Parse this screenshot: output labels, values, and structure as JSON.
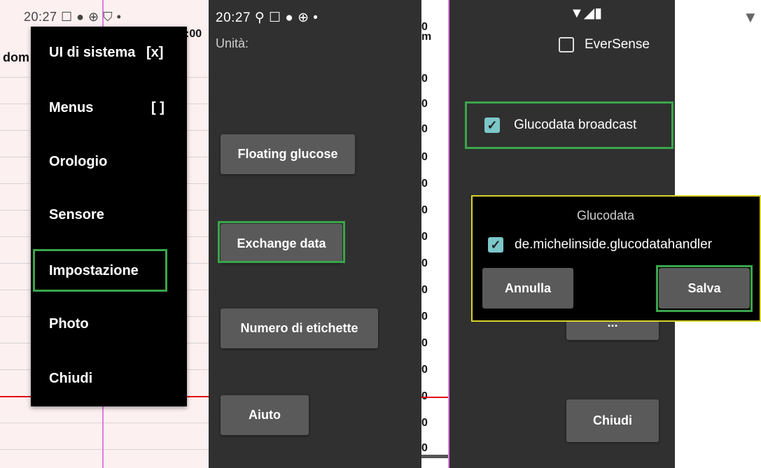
{
  "panel1": {
    "status_bar": "20:27 ☐ ● ⊕ ⛉ •",
    "graph_label_left": "dom",
    "graph_label_right": ":00",
    "menu_items": [
      {
        "label": "UI di sistema",
        "extra": "[x]"
      },
      {
        "label": "Menus",
        "extra": "[ ]"
      },
      {
        "label": "Orologio",
        "extra": ""
      },
      {
        "label": "Sensore",
        "extra": ""
      },
      {
        "label": "Impostazione",
        "extra": ""
      },
      {
        "label": "Photo",
        "extra": ""
      },
      {
        "label": "Chiudi",
        "extra": ""
      }
    ]
  },
  "panel2": {
    "status_bar": "20:27 ⚲ ☐ ● ⊕ •",
    "units_label": "Unità:",
    "buttons": [
      "Floating glucose",
      "Exchange data",
      "Numero di etichette",
      "Aiuto"
    ]
  },
  "strip": {
    "ticks": [
      "0",
      "m",
      "0",
      "0",
      "0",
      "0",
      "0",
      "0",
      "0",
      "0",
      "0",
      "0",
      "0",
      "0",
      "0",
      "0",
      "0"
    ]
  },
  "panel3": {
    "status_bar": "▼◢▮",
    "eversense_label": "EverSense",
    "glucodata_broadcast_label": "Glucodata broadcast",
    "hidden_button_partial": "...",
    "close_button": "Chiudi"
  },
  "dialog": {
    "title": "Glucodata",
    "option_label": "de.michelinside.glucodatahandler",
    "cancel_label": "Annulla",
    "save_label": "Salva"
  },
  "colors": {
    "highlight": "#3aa54a",
    "dialog_border": "#d7d32b",
    "checkbox_checked": "#7cc7c9"
  }
}
